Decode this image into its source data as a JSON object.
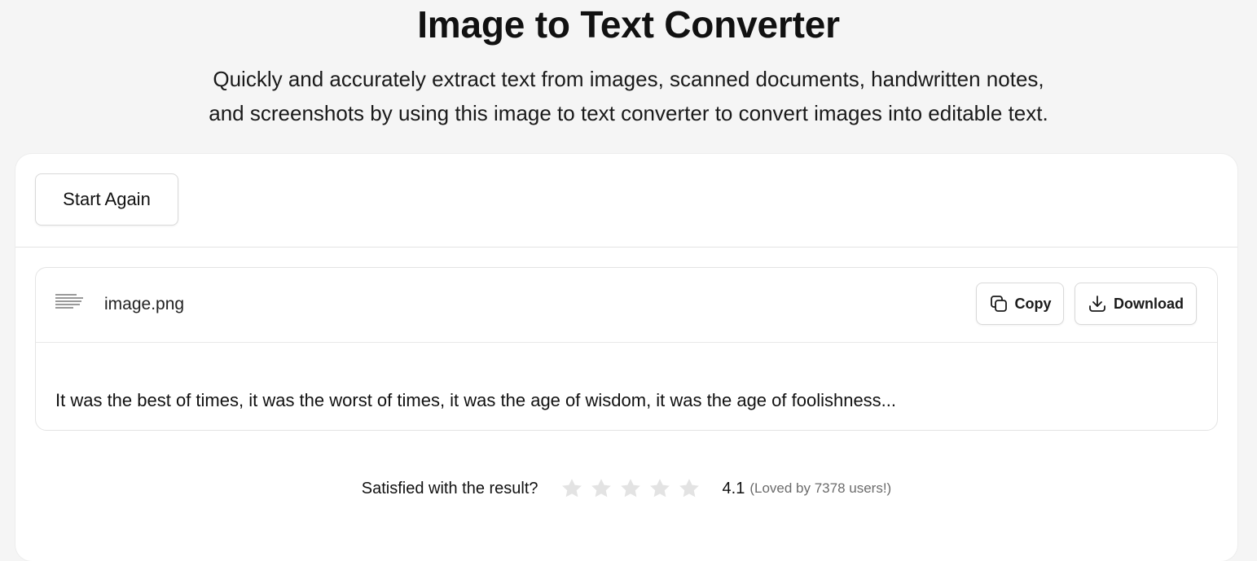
{
  "header": {
    "title": "Image to Text Converter",
    "subtitle_line1": "Quickly and accurately extract text from images, scanned documents, handwritten notes,",
    "subtitle_line2": "and screenshots by using this image to text converter to convert images into editable text."
  },
  "toolbar": {
    "start_again_label": "Start Again"
  },
  "result": {
    "filename": "image.png",
    "thumbnail_icon": "document-thumbnail",
    "copy_label": "Copy",
    "copy_icon": "copy-icon",
    "download_label": "Download",
    "download_icon": "download-icon",
    "extracted_text": "It was the best of times, it was the worst of times, it was the age of wisdom, it was the age of foolishness..."
  },
  "rating": {
    "question": "Satisfied with the result?",
    "stars_total": 5,
    "stars_filled": 0,
    "star_color": "#e3e3e3",
    "score": "4.1",
    "loved_text": "(Loved by 7378 users!)"
  }
}
